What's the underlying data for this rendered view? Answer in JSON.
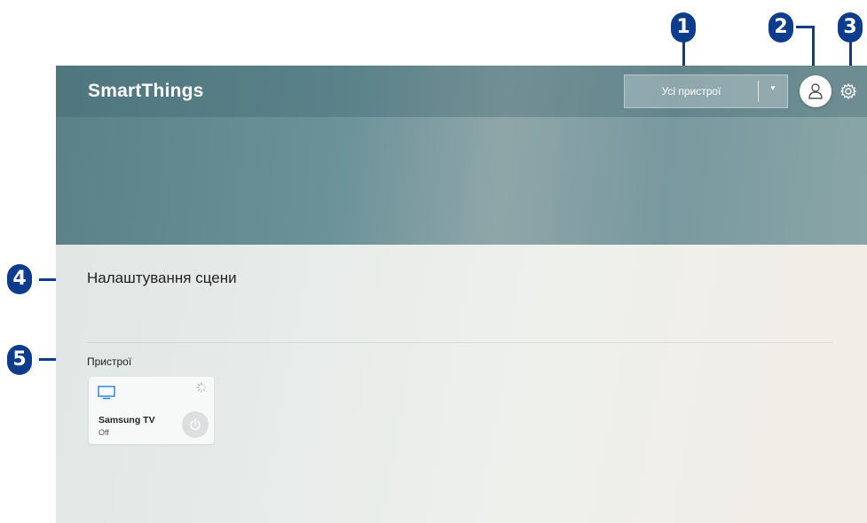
{
  "header": {
    "app_title": "SmartThings",
    "filter": {
      "selected": "Усі пристрої"
    },
    "icons": {
      "account": "account-icon",
      "settings": "gear-icon",
      "dropdown": "caret-down-icon"
    }
  },
  "scene": {
    "title": "Налаштування сцени"
  },
  "devices": {
    "title": "Пристрої",
    "items": [
      {
        "name": "Samsung TV",
        "status": "Off",
        "icon": "tv-icon"
      }
    ]
  },
  "callouts": [
    "1",
    "2",
    "3",
    "4",
    "5"
  ],
  "colors": {
    "callout": "#0e3c8c",
    "banner": "#6b9299"
  }
}
